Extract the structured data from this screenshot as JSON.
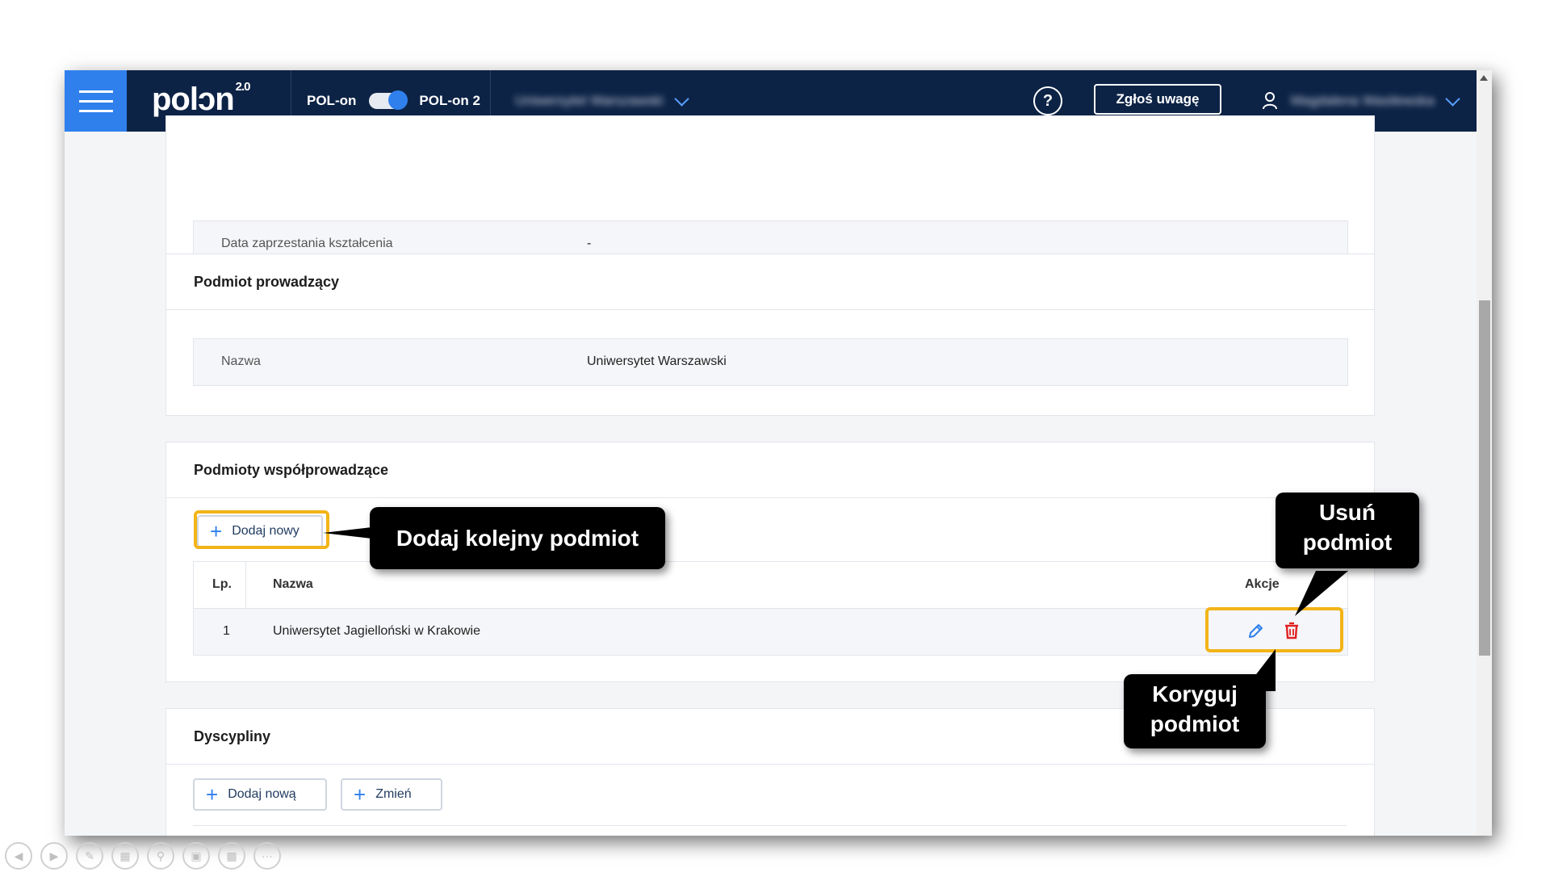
{
  "navbar": {
    "logo_text": "polɔn",
    "logo_version": "2.0",
    "toggle_left_label": "POL-on",
    "toggle_right_label": "POL-on 2",
    "university_select": "Uniwersytet Warszawski",
    "help_label": "?",
    "report_button": "Zgłoś uwagę",
    "user_name": "Magdalena Wasilewska"
  },
  "graduation_section": {
    "label": "Data zaprzestania kształcenia",
    "value": "-"
  },
  "lead_entity": {
    "title": "Podmiot prowadzący",
    "name_label": "Nazwa",
    "name_value": "Uniwersytet Warszawski"
  },
  "co_entities": {
    "title": "Podmioty współprowadzące",
    "add_button": "Dodaj nowy",
    "columns": {
      "lp": "Lp.",
      "name": "Nazwa",
      "actions": "Akcje"
    },
    "rows": [
      {
        "lp": "1",
        "name": "Uniwersytet Jagielloński w Krakowie"
      }
    ]
  },
  "disciplines": {
    "title": "Dyscypliny",
    "add_button": "Dodaj nową",
    "change_button": "Zmień"
  },
  "callouts": {
    "add": "Dodaj kolejny podmiot",
    "delete_line1": "Usuń",
    "delete_line2": "podmiot",
    "edit_line1": "Koryguj",
    "edit_line2": "podmiot"
  },
  "colors": {
    "navbar_bg": "#0d2346",
    "accent_blue": "#2f80ed",
    "highlight_yellow": "#f2b418",
    "delete_red": "#e02020"
  }
}
